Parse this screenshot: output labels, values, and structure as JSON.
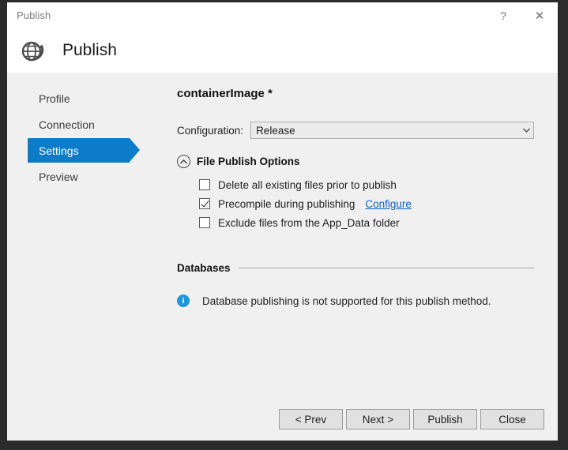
{
  "window": {
    "title": "Publish",
    "help_label": "?",
    "close_label": "✕"
  },
  "header": {
    "icon": "globe-publish-icon",
    "title": "Publish"
  },
  "sidebar": {
    "items": [
      {
        "label": "Profile",
        "active": false
      },
      {
        "label": "Connection",
        "active": false
      },
      {
        "label": "Settings",
        "active": true
      },
      {
        "label": "Preview",
        "active": false
      }
    ]
  },
  "main": {
    "profile_title": "containerImage *",
    "configuration": {
      "label": "Configuration:",
      "value": "Release",
      "arrow": "⌄",
      "options": [
        "Release"
      ]
    },
    "file_publish_options": {
      "collapse_icon": "∧",
      "title": "File Publish Options",
      "checkboxes": [
        {
          "label": "Delete all existing files prior to publish",
          "checked": false,
          "link": ""
        },
        {
          "label": "Precompile during publishing",
          "checked": true,
          "link": "Configure"
        },
        {
          "label": "Exclude files from the App_Data folder",
          "checked": false,
          "link": ""
        }
      ]
    },
    "databases": {
      "title": "Databases",
      "info_icon": "i",
      "message": "Database publishing is not supported for this publish method."
    }
  },
  "footer": {
    "buttons": [
      {
        "label": "< Prev"
      },
      {
        "label": "Next >"
      },
      {
        "label": "Publish"
      },
      {
        "label": "Close"
      }
    ]
  },
  "colors": {
    "accent": "#0c7cc8",
    "link": "#0a64c8",
    "info": "#2196d8",
    "body_bg": "#f0f0f0",
    "desktop_bg": "#2b2b2b"
  }
}
